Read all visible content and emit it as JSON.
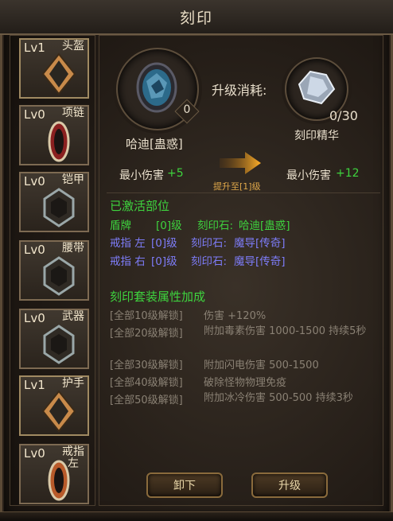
{
  "title": "刻印",
  "slots": [
    {
      "level": "Lv1",
      "name": "头盔"
    },
    {
      "level": "Lv0",
      "name": "项链"
    },
    {
      "level": "Lv0",
      "name": "铠甲"
    },
    {
      "level": "Lv0",
      "name": "腰带"
    },
    {
      "level": "Lv0",
      "name": "武器"
    },
    {
      "level": "Lv1",
      "name": "护手"
    },
    {
      "level": "Lv0",
      "name": "戒指",
      "sub": "左"
    }
  ],
  "current": {
    "gem_name": "哈迪[蛊惑]",
    "gem_level": "0"
  },
  "cost": {
    "label": "升级消耗:",
    "item_name": "刻印精华",
    "count": "0/30"
  },
  "upgrade": {
    "current_stat": "最小伤害",
    "current_value": "+5",
    "arrow_label": "提升至[1]级",
    "next_stat": "最小伤害",
    "next_value": "+12"
  },
  "activated": {
    "header": "已激活部位",
    "rows": [
      {
        "part": "盾牌",
        "level": "[0]级",
        "stone_label": "刻印石:",
        "stone": "哈迪[蛊惑]"
      },
      {
        "part": "戒指 左",
        "level": "[0]级",
        "stone_label": "刻印石:",
        "stone": "魔导[传奇]"
      },
      {
        "part": "戒指 右",
        "level": "[0]级",
        "stone_label": "刻印石:",
        "stone": "魔导[传奇]"
      }
    ]
  },
  "set_bonus": {
    "header": "刻印套装属性加成",
    "rows": [
      {
        "req": "[全部10级解锁]",
        "effect": "伤害 +120%"
      },
      {
        "req": "[全部20级解锁]",
        "effect": "附加毒素伤害 1000-1500 持续5秒"
      },
      {
        "req": "[全部30级解锁]",
        "effect": "附加闪电伤害 500-1500"
      },
      {
        "req": "[全部40级解锁]",
        "effect": "破除怪物物理免疫"
      },
      {
        "req": "[全部50级解锁]",
        "effect": "附加冰冷伤害 500-500 持续3秒"
      }
    ]
  },
  "buttons": {
    "unequip": "卸下",
    "upgrade": "升级"
  }
}
